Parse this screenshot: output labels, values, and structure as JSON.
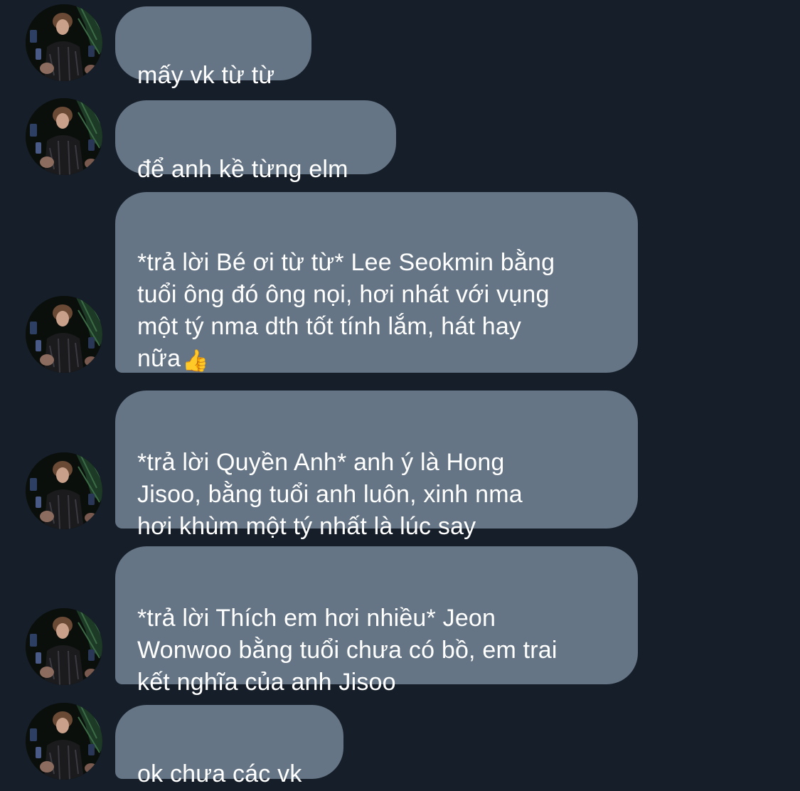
{
  "colors": {
    "background": "#161f29",
    "bubble": "#657585",
    "text": "#ffffff"
  },
  "avatar_icon": "profile-photo",
  "messages": [
    {
      "text": "mấy vk từ từ"
    },
    {
      "text": "để anh kề từng elm"
    },
    {
      "text": "*trả lời Bé ơi từ từ* Lee Seokmin bằng\ntuổi ông đó ông nọi, hơi nhát với vụng\nmột tý nma dth tốt tính lắm, hát hay\nnữa",
      "emoji": "👍"
    },
    {
      "text": "*trả lời Quyền Anh* anh ý là Hong\nJisoo, bằng tuổi anh luôn, xinh nma\nhơi khùm một tý nhất là lúc say"
    },
    {
      "text": "*trả lời Thích em hơi nhiều* Jeon\nWonwoo bằng tuổi chưa có bồ, em trai\nkết nghĩa của anh Jisoo"
    },
    {
      "text": "ok chưa các vk"
    }
  ]
}
